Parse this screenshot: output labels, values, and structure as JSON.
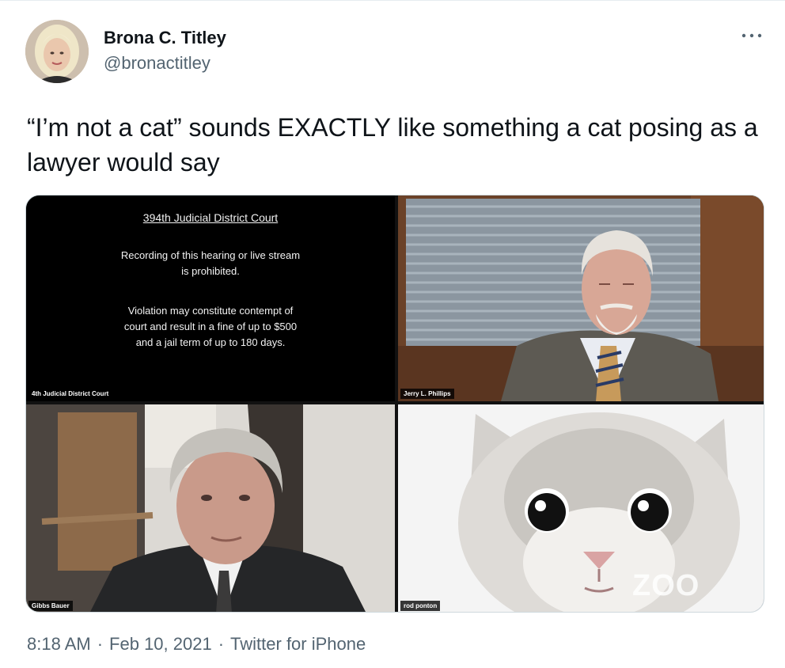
{
  "author": {
    "name": "Brona C. Titley",
    "handle": "@bronactitley"
  },
  "tweet_text": "“I’m not a cat” sounds EXACTLY like something a cat posing as a lawyer would say",
  "media": {
    "court_notice": {
      "title": "394th Judicial District Court",
      "lines": [
        "Recording of this hearing or live stream",
        "is prohibited.",
        "Violation may constitute contempt of",
        "court and result in a fine of up to $500",
        "and a jail term of up to 180 days."
      ],
      "label": "4th Judicial District Court"
    },
    "judge_label": "Jerry L. Phillips",
    "lawyer_label": "Gibbs Bauer",
    "cat_label": "rod ponton",
    "zoom_watermark": "ZOO"
  },
  "meta": {
    "time": "8:18 AM",
    "date": "Feb 10, 2021",
    "source": "Twitter for iPhone"
  },
  "icons": {
    "more": "more-horizontal-icon"
  }
}
